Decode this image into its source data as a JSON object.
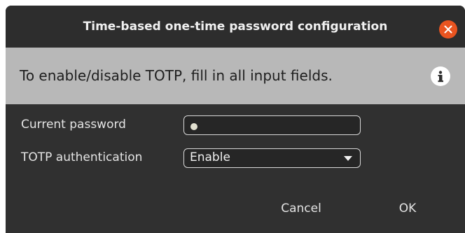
{
  "dialog": {
    "title": "Time-based one-time password configuration",
    "close_icon": "close-icon"
  },
  "info": {
    "message": "To enable/disable TOTP, fill in all input fields.",
    "icon": "info-icon"
  },
  "form": {
    "password_label": "Current password",
    "password_value_mask": "●",
    "totp_label": "TOTP authentication",
    "totp_selected": "Enable"
  },
  "buttons": {
    "cancel": "Cancel",
    "ok": "OK"
  },
  "colors": {
    "accent": "#e95420",
    "background": "#303030",
    "infobar": "#b8b8b8"
  }
}
